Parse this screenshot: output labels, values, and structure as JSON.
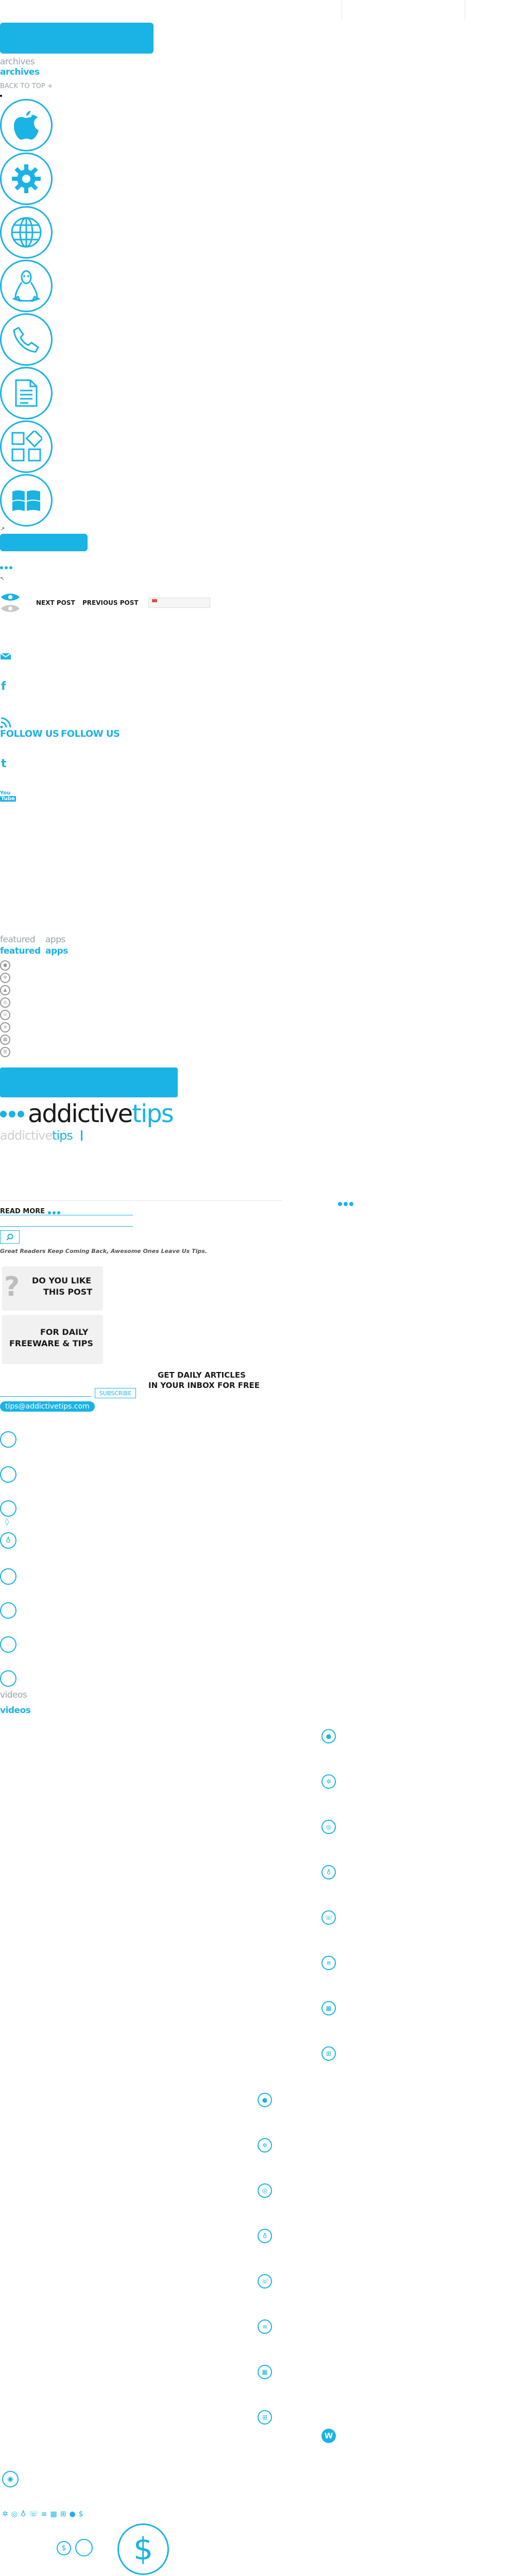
{
  "top": {
    "archives_grey": "archives",
    "archives_blue": "archives",
    "back_to_top": "BACK TO TOP +"
  },
  "category_icons": [
    "apple-icon",
    "gear-icon",
    "globe-icon",
    "linux-icon",
    "phone-icon",
    "document-icon",
    "windows8-icon",
    "windows-icon"
  ],
  "post_nav": {
    "next": "NEXT POST",
    "previous": "PREVIOUS POST"
  },
  "follow": {
    "label_dark": "FOLLOW US",
    "label_blue": "FOLLOW US",
    "twitter": "t",
    "youtube_top": "You",
    "youtube_bottom": "Tube",
    "facebook": "f"
  },
  "featured": {
    "featured_grey": "featured",
    "apps_grey": "apps",
    "featured_blue": "featured",
    "apps_blue": "apps"
  },
  "logo": {
    "main": "addictive",
    "main_accent": "tips",
    "grey": "addictive",
    "grey_accent": "tips"
  },
  "read_more": "READ MORE",
  "great_readers": "Great Readers Keep Coming Back, Awesome Ones Leave Us Tips.",
  "like_box": {
    "line1": "DO YOU LIKE",
    "line2": "THIS POST"
  },
  "daily_box": {
    "line1": "FOR DAILY",
    "line2": "FREEWARE & TIPS"
  },
  "newsletter": {
    "line1": "GET DAILY ARTICLES",
    "line2": "IN YOUR INBOX FOR FREE",
    "subscribe": "SUBSCRIBE",
    "email": "tips@addictivetips.com"
  },
  "videos": {
    "grey": "videos",
    "blue": "videos"
  },
  "big_dollar": "$",
  "small_dollar": "$",
  "colors": {
    "accent": "#19b3e6",
    "grey": "#9aa3a8"
  }
}
